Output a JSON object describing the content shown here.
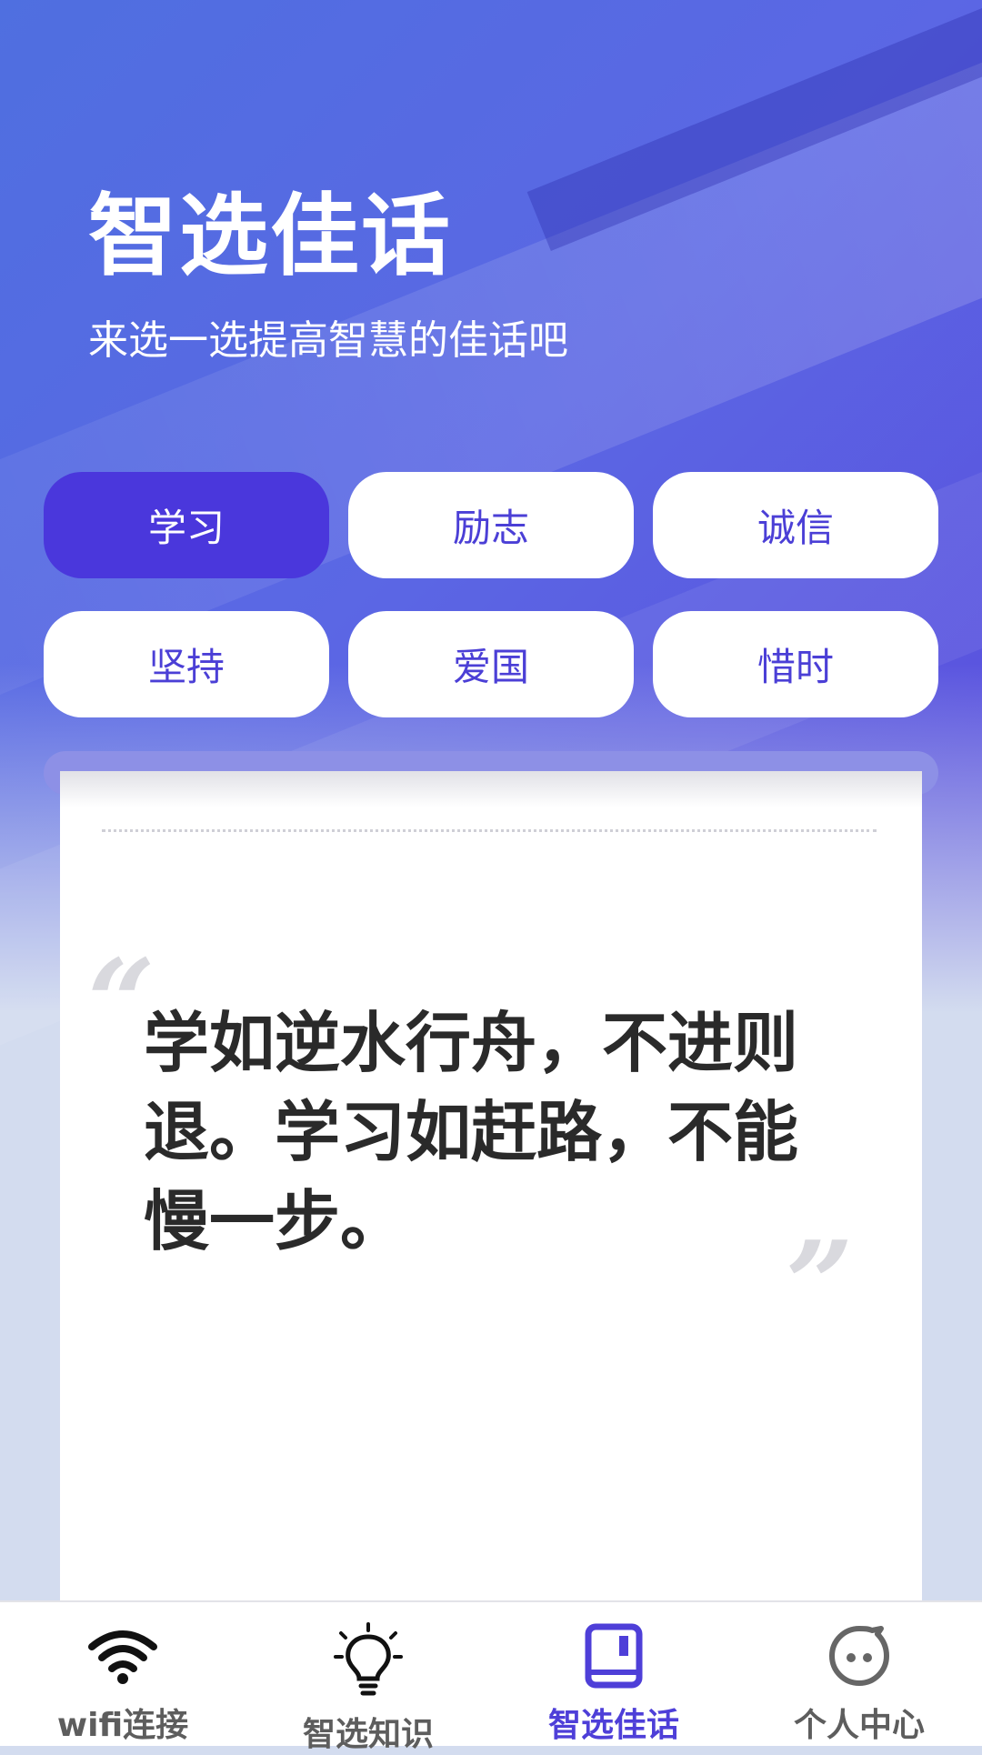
{
  "header": {
    "title": "智选佳话",
    "subtitle": "来选一选提高智慧的佳话吧"
  },
  "categories": [
    {
      "label": "学习",
      "active": true
    },
    {
      "label": "励志",
      "active": false
    },
    {
      "label": "诚信",
      "active": false
    },
    {
      "label": "坚持",
      "active": false
    },
    {
      "label": "爱国",
      "active": false
    },
    {
      "label": "惜时",
      "active": false
    }
  ],
  "quote": {
    "open_mark": "“",
    "close_mark": "”",
    "text": "学如逆水行舟，不进则退。学习如赶路，不能慢一步。"
  },
  "tabbar": {
    "items": [
      {
        "label": "wifi连接",
        "icon": "wifi-icon",
        "active": false
      },
      {
        "label": "智选知识",
        "icon": "lightbulb-icon",
        "active": false
      },
      {
        "label": "智选佳话",
        "icon": "book-icon",
        "active": true
      },
      {
        "label": "个人中心",
        "icon": "face-icon",
        "active": false
      }
    ]
  },
  "colors": {
    "accent": "#4a37dc",
    "accent_text": "#4b3fd6",
    "tab_inactive": "#5d5d5d",
    "tab_active": "#4e3fd8",
    "card_rail": "#8d90e6"
  }
}
